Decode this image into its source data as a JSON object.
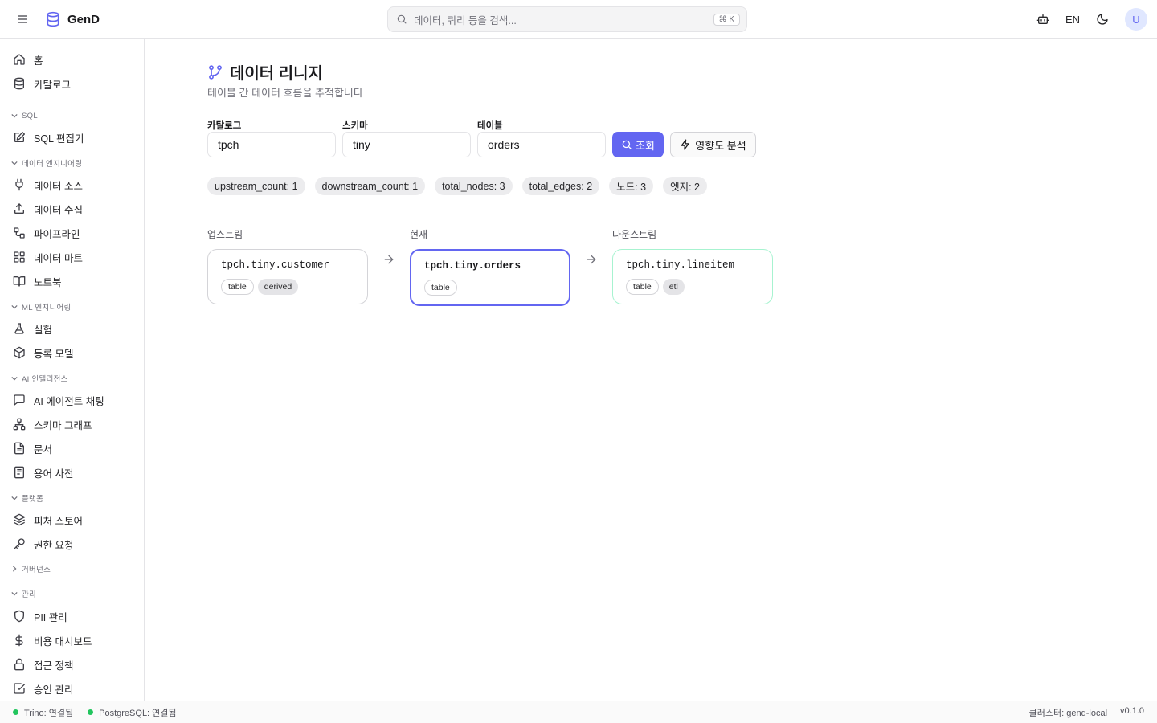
{
  "app": {
    "name": "GenD"
  },
  "search": {
    "placeholder": "데이터, 쿼리 등을 검색...",
    "shortcut": "⌘ K"
  },
  "header": {
    "lang": "EN",
    "avatar_initial": "U"
  },
  "sidebar": {
    "items_top": [
      {
        "label": "홈",
        "icon": "home-icon"
      },
      {
        "label": "카탈로그",
        "icon": "database-icon"
      }
    ],
    "sections": [
      {
        "label": "SQL",
        "expanded": true,
        "items": [
          {
            "label": "SQL 편집기",
            "icon": "edit-icon"
          }
        ]
      },
      {
        "label": "데이터 엔지니어링",
        "expanded": true,
        "items": [
          {
            "label": "데이터 소스",
            "icon": "plug-icon"
          },
          {
            "label": "데이터 수집",
            "icon": "upload-icon"
          },
          {
            "label": "파이프라인",
            "icon": "workflow-icon"
          },
          {
            "label": "데이터 마트",
            "icon": "grid-icon"
          },
          {
            "label": "노트북",
            "icon": "book-icon"
          }
        ]
      },
      {
        "label": "ML 엔지니어링",
        "expanded": true,
        "items": [
          {
            "label": "실험",
            "icon": "flask-icon"
          },
          {
            "label": "등록 모델",
            "icon": "box-icon"
          }
        ]
      },
      {
        "label": "AI 인텔리전스",
        "expanded": true,
        "items": [
          {
            "label": "AI 에이전트 채팅",
            "icon": "chat-icon"
          },
          {
            "label": "스키마 그래프",
            "icon": "network-icon"
          },
          {
            "label": "문서",
            "icon": "file-icon"
          },
          {
            "label": "용어 사전",
            "icon": "glossary-icon"
          }
        ]
      },
      {
        "label": "플랫폼",
        "expanded": true,
        "items": [
          {
            "label": "피처 스토어",
            "icon": "layers-icon"
          },
          {
            "label": "권한 요청",
            "icon": "key-icon"
          }
        ]
      },
      {
        "label": "거버넌스",
        "expanded": false,
        "items": []
      },
      {
        "label": "관리",
        "expanded": true,
        "items": [
          {
            "label": "PII 관리",
            "icon": "shield-icon"
          },
          {
            "label": "비용 대시보드",
            "icon": "dollar-icon"
          },
          {
            "label": "접근 정책",
            "icon": "lock-icon"
          },
          {
            "label": "승인 관리",
            "icon": "check-square-icon"
          }
        ]
      }
    ]
  },
  "page": {
    "title": "데이터 리니지",
    "subtitle": "테이블 간 데이터 흐름을 추적합니다"
  },
  "form": {
    "catalog": {
      "label": "카탈로그",
      "value": "tpch"
    },
    "schema": {
      "label": "스키마",
      "value": "tiny"
    },
    "table": {
      "label": "테이블",
      "value": "orders"
    },
    "query_button": "조회",
    "impact_button": "영향도 분석"
  },
  "stats": [
    "upstream_count: 1",
    "downstream_count: 1",
    "total_nodes: 3",
    "total_edges: 2",
    "노드: 3",
    "엣지: 2"
  ],
  "lineage": {
    "upstream": {
      "label": "업스트림",
      "node": {
        "name": "tpch.tiny.customer",
        "tags": [
          "table",
          "derived"
        ]
      }
    },
    "current": {
      "label": "현재",
      "node": {
        "name": "tpch.tiny.orders",
        "tags": [
          "table"
        ]
      }
    },
    "downstream": {
      "label": "다운스트림",
      "node": {
        "name": "tpch.tiny.lineitem",
        "tags": [
          "table",
          "etl"
        ]
      }
    }
  },
  "colors": {
    "accent": "#6366f1",
    "upstream_border": "#d4d4d8",
    "current_border": "#6366f1",
    "downstream_border": "#a7f3d0",
    "status_ok": "#22c55e"
  },
  "statusbar": {
    "trino": "Trino: 연결됨",
    "postgres": "PostgreSQL: 연결됨",
    "cluster": "클러스터: gend-local",
    "version": "v0.1.0"
  }
}
